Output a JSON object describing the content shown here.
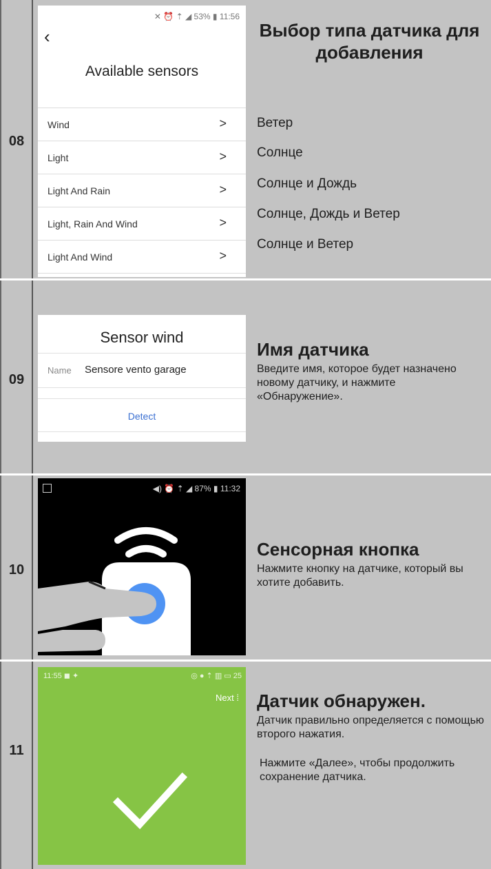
{
  "steps": {
    "s08": {
      "number": "08",
      "phone": {
        "status_icons": "✕ ⏰ ⇡ ◢",
        "battery": "53%",
        "time": "11:56",
        "back_icon": "chevron-left-icon",
        "title": "Available sensors",
        "items": [
          {
            "label": "Wind"
          },
          {
            "label": "Light"
          },
          {
            "label": "Light And Rain"
          },
          {
            "label": "Light, Rain And Wind"
          },
          {
            "label": "Light And Wind"
          }
        ]
      },
      "heading": "Выбор типа датчика для добавления",
      "options": [
        "Ветер",
        "Солнце",
        "Солнце и Дождь",
        "Солнце, Дождь и Ветер",
        "Солнце и Ветер"
      ]
    },
    "s09": {
      "number": "09",
      "panel": {
        "title": "Sensor wind",
        "name_label": "Name",
        "name_value": "Sensore vento garage",
        "detect": "Detect"
      },
      "heading": "Имя датчика",
      "text": "Введите имя, которое будет назначено новому датчику, и нажмите «Обнаружение»."
    },
    "s10": {
      "number": "10",
      "phone": {
        "status_icons": "◀) ⏰ ⇡ ◢",
        "battery": "87%",
        "time": "11:32"
      },
      "heading": "Сенсорная кнопка",
      "text": "Нажмите кнопку на датчике, который вы хотите добавить."
    },
    "s11": {
      "number": "11",
      "phone": {
        "time": "11:55",
        "status_right": "25",
        "next": "Next"
      },
      "heading": "Датчик обнаружен.",
      "text1": "Датчик правильно определяется с помощью второго нажатия.",
      "text2": "Нажмите «Далее», чтобы продолжить сохранение датчика."
    }
  },
  "colors": {
    "background": "#c3c3c3",
    "green_screen": "#86c445",
    "sensor_button": "#4f93f3",
    "detect_link": "#3a6fd1"
  }
}
